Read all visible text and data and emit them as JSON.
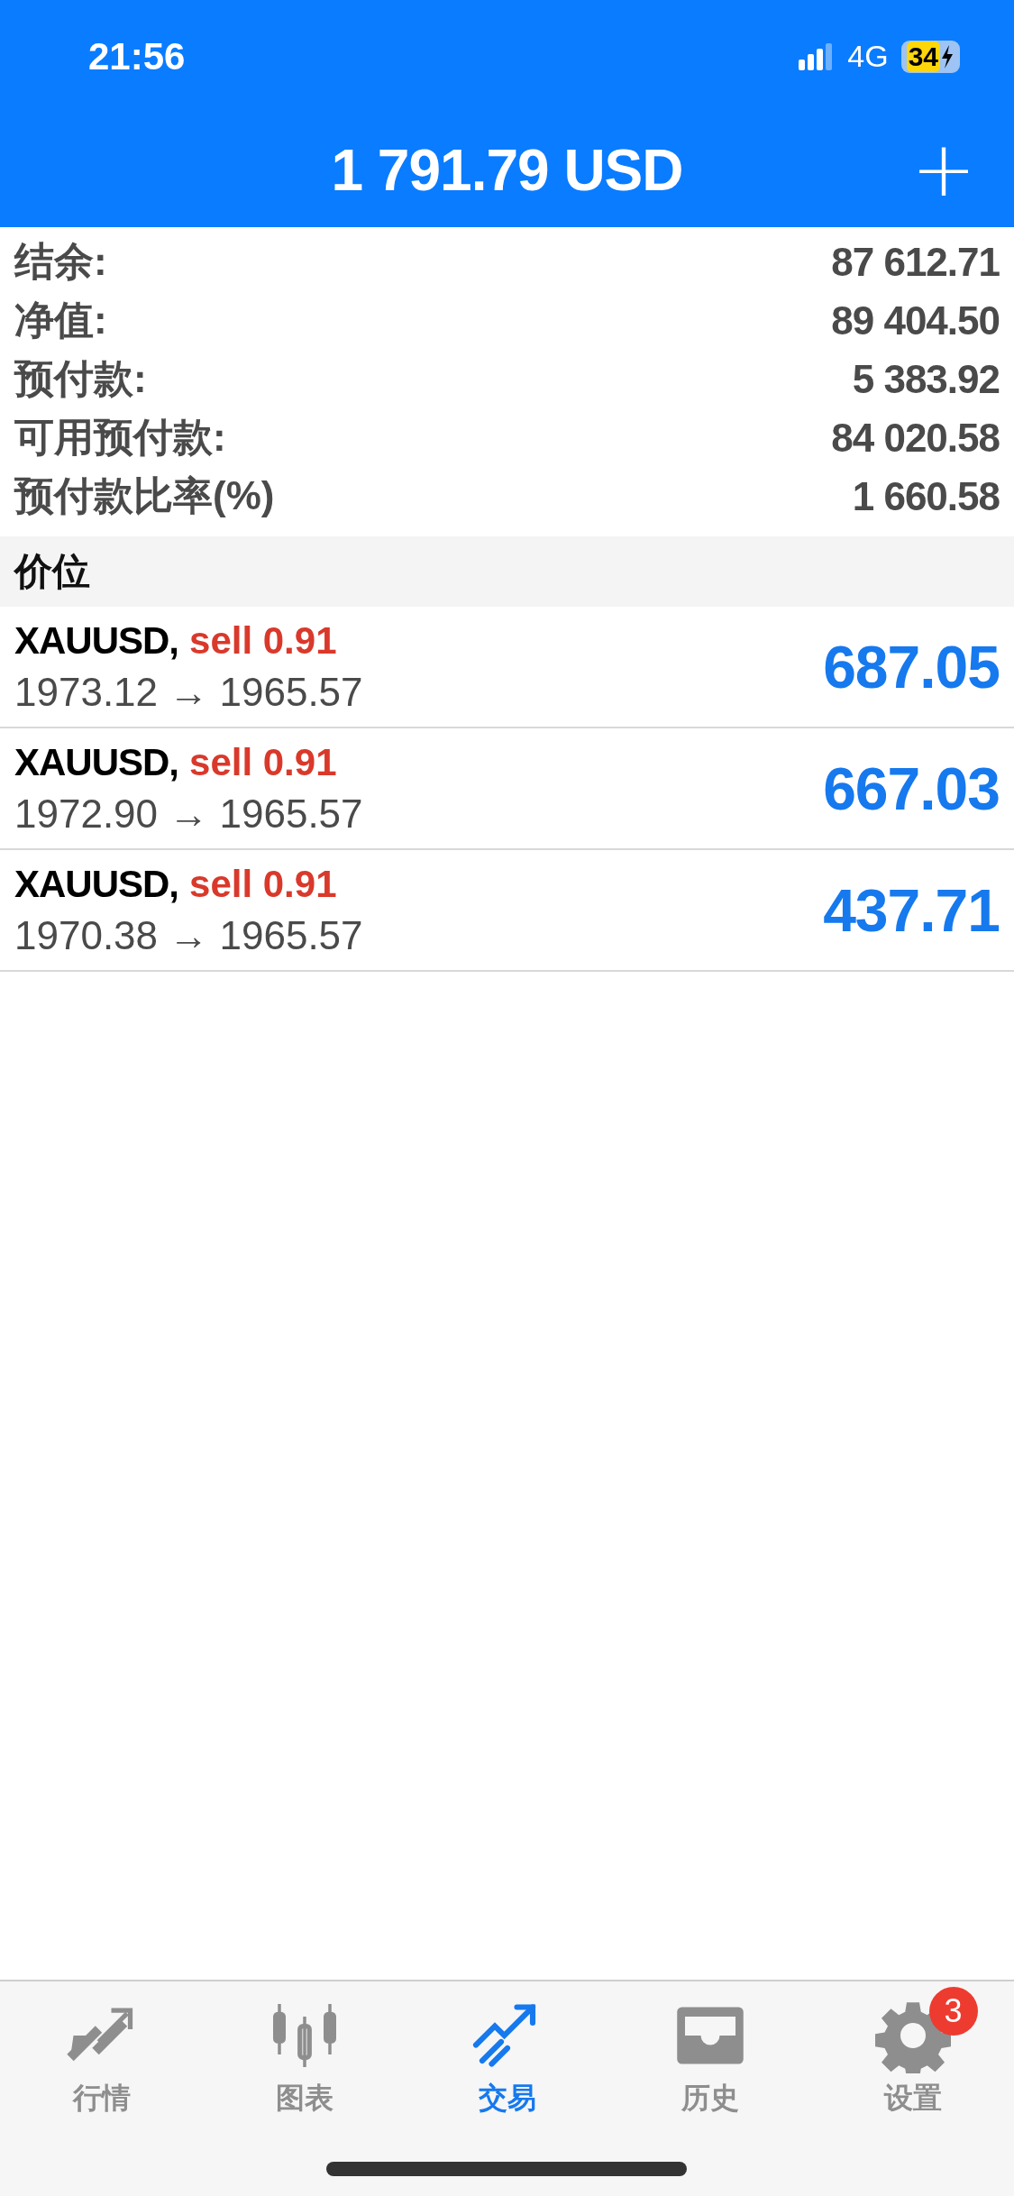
{
  "status_bar": {
    "time": "21:56",
    "network": "4G",
    "battery": "34"
  },
  "header": {
    "title": "1 791.79 USD",
    "add_button": "+"
  },
  "summary": [
    {
      "label": "结余:",
      "value": "87 612.71"
    },
    {
      "label": "净值:",
      "value": "89 404.50"
    },
    {
      "label": "预付款:",
      "value": "5 383.92"
    },
    {
      "label": "可用预付款:",
      "value": "84 020.58"
    },
    {
      "label": "预付款比率(%)",
      "value": "1 660.58"
    }
  ],
  "positions_header": "价位",
  "positions": [
    {
      "symbol": "XAUUSD,",
      "order": "sell 0.91",
      "prices": "1973.12 → 1965.57",
      "profit": "687.05"
    },
    {
      "symbol": "XAUUSD,",
      "order": "sell 0.91",
      "prices": "1972.90 → 1965.57",
      "profit": "667.03"
    },
    {
      "symbol": "XAUUSD,",
      "order": "sell 0.91",
      "prices": "1970.38 → 1965.57",
      "profit": "437.71"
    }
  ],
  "tabs": [
    {
      "kind": "quotes",
      "label": "行情",
      "selected": false
    },
    {
      "kind": "chart",
      "label": "图表",
      "selected": false
    },
    {
      "kind": "trade",
      "label": "交易",
      "selected": true
    },
    {
      "kind": "history",
      "label": "历史",
      "selected": false
    },
    {
      "kind": "settings",
      "label": "设置",
      "selected": false,
      "badge": "3"
    }
  ]
}
